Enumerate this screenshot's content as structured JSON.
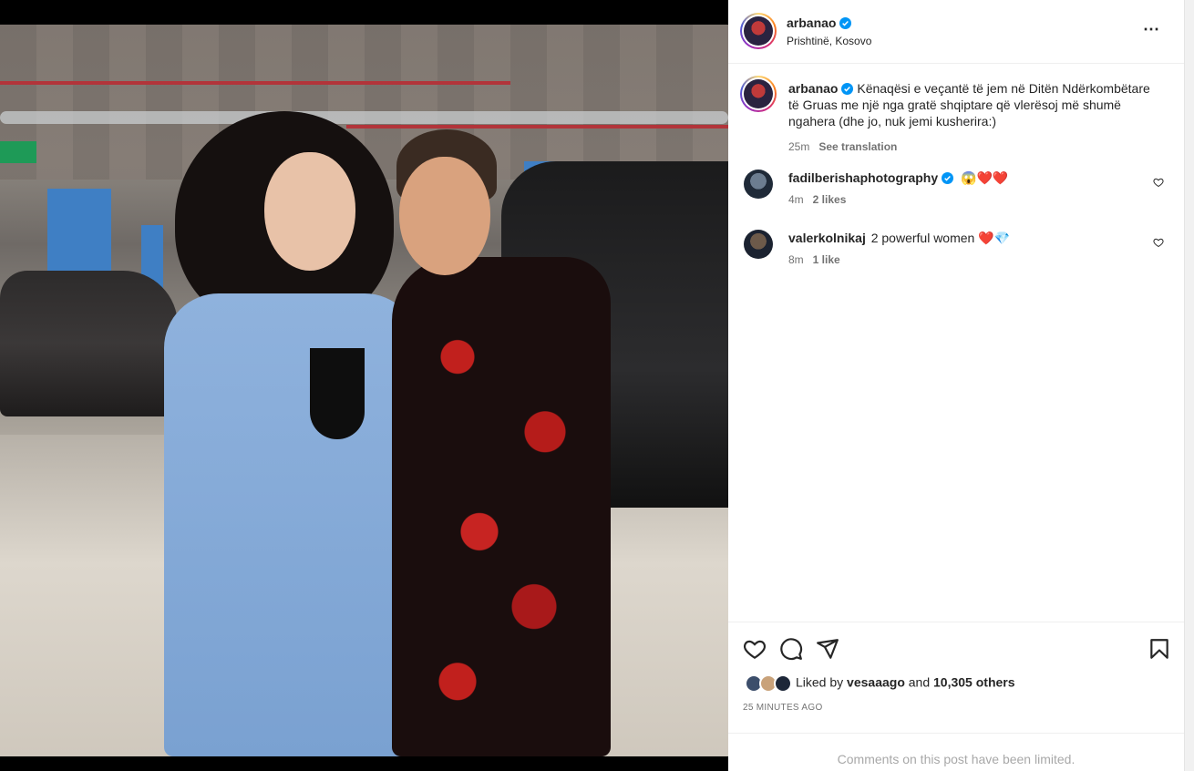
{
  "post": {
    "username": "arbanao",
    "location": "Prishtinë, Kosovo",
    "caption": "Kënaqësi e veçantë të jem në Ditën Ndërkombëtare të Gruas me një nga gratë shqiptare që vlerësoj më shumë ngahera (dhe jo, nuk jemi kusherira:)",
    "caption_time": "25m",
    "see_translation": "See translation",
    "more_icon": "⋯",
    "verified_color": "#0095f6"
  },
  "comments": [
    {
      "username": "fadilberishaphotography",
      "verified": true,
      "text": "😱❤️❤️",
      "time": "4m",
      "likes": "2 likes"
    },
    {
      "username": "valerkolnikaj",
      "verified": false,
      "text": "2 powerful women ❤️💎",
      "time": "8m",
      "likes": "1 like"
    }
  ],
  "actions": {
    "liked_by_prefix": "Liked by",
    "liked_by_user": "vesaaago",
    "liked_by_and": "and",
    "liked_by_others": "10,305 others",
    "time_ago": "25 MINUTES AGO",
    "icons": [
      "heart-icon",
      "comment-icon",
      "share-icon",
      "bookmark-icon"
    ]
  },
  "footer": {
    "limited": "Comments on this post have been limited."
  }
}
